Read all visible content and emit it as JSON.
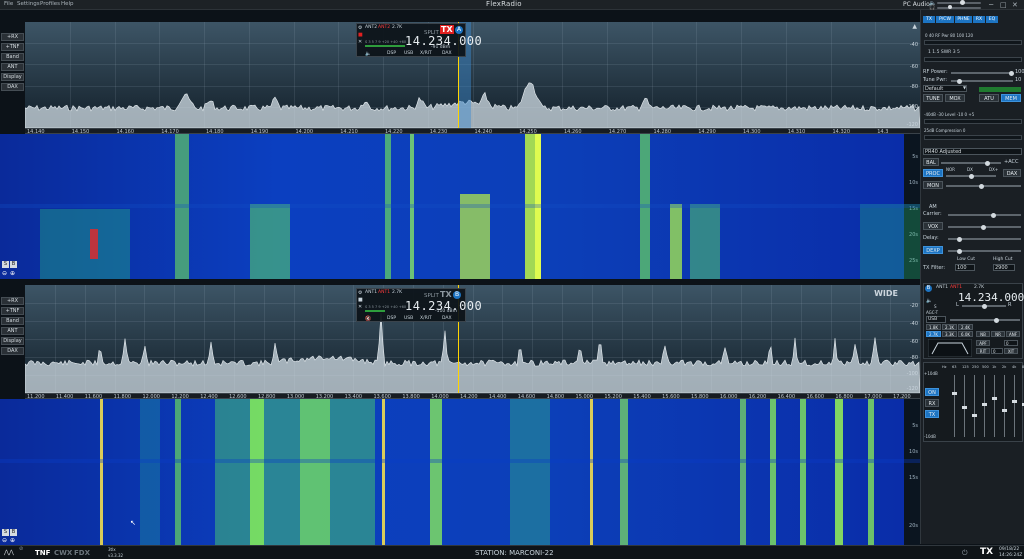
{
  "menu": {
    "file": "File",
    "settings": "Settings",
    "profiles": "Profiles",
    "help": "Help"
  },
  "app_title": "FlexRadio",
  "audio_label": "PC Audio",
  "left_buttons": [
    "+RX",
    "+TNF",
    "Band",
    "ANT",
    "Display",
    "DAX"
  ],
  "pan1": {
    "db_labels": [
      "-40",
      "-60",
      "-80",
      "-100",
      "-120"
    ],
    "freq_ticks": [
      "14.140",
      "14.150",
      "14.160",
      "14.170",
      "14.180",
      "14.190",
      "14.200",
      "14.210",
      "14.220",
      "14.230",
      "14.240",
      "14.250",
      "14.260",
      "14.270",
      "14.280",
      "14.290",
      "14.300",
      "14.310",
      "14.320",
      "14.3"
    ],
    "wf_times": [
      "5s",
      "10s",
      "15s",
      "20s",
      "25s"
    ],
    "vfo": {
      "ant1": "ANT2",
      "ant2": "ANT2",
      "bw": "2.7K",
      "split": "SPLIT",
      "tx": "TX",
      "slice": "A",
      "freq": "14.234.000",
      "dbm": "-91 dBm",
      "meter_scale": "S   3   5   7   9   +20   +40   +60",
      "dsp": "DSP",
      "mode": "USB",
      "xrit": "X/RIT",
      "dax": "DAX"
    }
  },
  "pan2": {
    "db_labels": [
      "-20",
      "-40",
      "-60",
      "-80",
      "-100",
      "-120"
    ],
    "freq_ticks": [
      "11.200",
      "11.400",
      "11.600",
      "11.800",
      "12.000",
      "12.200",
      "12.400",
      "12.600",
      "12.800",
      "13.000",
      "13.200",
      "13.400",
      "13.600",
      "13.800",
      "14.000",
      "14.200",
      "14.400",
      "14.600",
      "14.800",
      "15.000",
      "15.200",
      "15.400",
      "15.600",
      "15.800",
      "16.000",
      "16.200",
      "16.400",
      "16.600",
      "16.800",
      "17.000",
      "17.200"
    ],
    "wf_times": [
      "5s",
      "10s",
      "15s",
      "20s"
    ],
    "wide": "WIDE",
    "vfo": {
      "ant1": "ANT1",
      "ant2": "ANT1",
      "bw": "2.7K",
      "split": "SPLIT",
      "tx": "TX",
      "slice": "B",
      "freq": "14.234.000",
      "dbm": "-110 dBm",
      "meter_scale": "S   3   5   7   9   +20   +40   +60",
      "dsp": "DSP",
      "mode": "USB",
      "xrit": "X/RIT",
      "dax": "DAX"
    }
  },
  "right": {
    "tabs": [
      "TX",
      "P/CW",
      "PHNE",
      "RX",
      "EQ"
    ],
    "fwd_scale": "0   40   RF Pwr   80   100   120",
    "swr_scale": "1   1.5   SWR   3   5",
    "rf_power": "RF Power:",
    "rf_power_val": "100",
    "tune_pwr": "Tune Pwr:",
    "tune_pwr_val": "10",
    "profile": "Default",
    "tune": "TUNE",
    "mox": "MOX",
    "atu": "ATU",
    "mem": "MEM",
    "level_scale": "-40dB   -30   Level   -10   0   +5",
    "comp_scale": "25dB   Compression   0",
    "mic_profile": "PR40 Adjusted",
    "bal": "BAL",
    "acc": "+ACC",
    "proc": "PROC",
    "nor": "NOR",
    "dx": "DX",
    "dxx": "DX+",
    "dax": "DAX",
    "mon": "MON",
    "am": "AM",
    "carrier": "Carrier:",
    "vox": "VOX",
    "delay": "Delay:",
    "dexp": "DEXP",
    "low_cut": "Low Cut",
    "high_cut": "High Cut",
    "tx_filter": "TX Filter:",
    "tx_low": "100",
    "tx_high": "2900",
    "rx": {
      "ant1": "ANT1",
      "ant2": "ANT1",
      "bw": "2.7K",
      "freq": "14.234.000",
      "s": "S",
      "mute_l": "L",
      "mute_r": "R",
      "agc": "AGC-T",
      "mode": "USB",
      "bws": [
        "1.8K",
        "2.1K",
        "2.4K",
        "2.7K",
        "3.3K",
        "6.0K"
      ],
      "nb": "NB",
      "nr": "NR",
      "anf": "ANF",
      "apf": "APF",
      "rit": "RIT",
      "xit": "XIT",
      "rit_val": "0",
      "xit_val": "0"
    },
    "eq_bands": [
      "Hz",
      "63",
      "125",
      "250",
      "500",
      "1k",
      "2k",
      "4k",
      "8k"
    ],
    "eq_top": "+10dB",
    "eq_bot": "-10dB",
    "on": "ON",
    "rx_btn": "RX",
    "tx_btn": "TX"
  },
  "status": {
    "tnf": "TNF",
    "cwx": "CWX",
    "fdx": "FDX",
    "version": "3tlx",
    "version2": "v3.3.32",
    "station": "STATION:  MARCONI-22",
    "tx": "TX",
    "date": "09/18/22",
    "time": "14:26:24Z"
  }
}
